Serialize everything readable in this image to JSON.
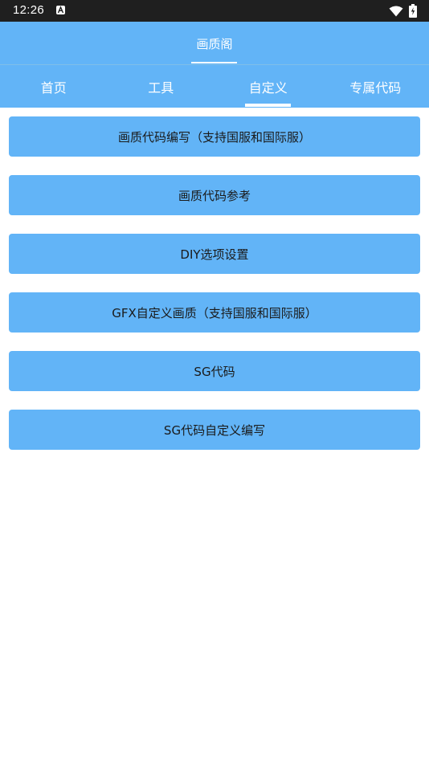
{
  "status_bar": {
    "time": "12:26",
    "notification_icon": "a-icon",
    "wifi_icon": "wifi-icon",
    "battery_icon": "battery-charging-icon"
  },
  "appbar": {
    "title": "画质阁"
  },
  "tabs": [
    {
      "label": "首页"
    },
    {
      "label": "工具"
    },
    {
      "label": "自定义"
    },
    {
      "label": "专属代码"
    }
  ],
  "selected_tab": "自定义",
  "buttons": [
    {
      "label": "画质代码编写（支持国服和国际服）"
    },
    {
      "label": "画质代码参考"
    },
    {
      "label": "DIY选项设置"
    },
    {
      "label": "GFX自定义画质（支持国服和国际服）"
    },
    {
      "label": "SG代码"
    },
    {
      "label": "SG代码自定义编写"
    }
  ],
  "colors": {
    "accent": "#62b4f7",
    "status_bar": "#1f1f1f",
    "background": "#ffffff",
    "button_text": "#1a1a1a"
  }
}
